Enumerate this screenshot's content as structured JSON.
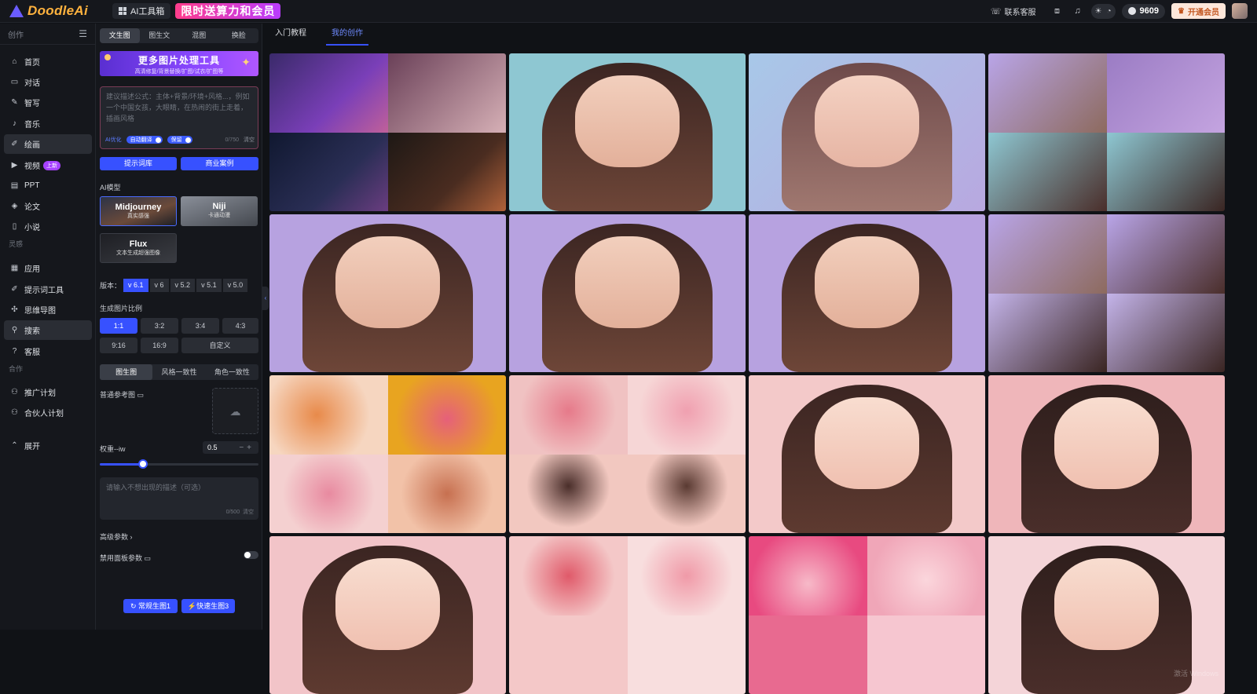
{
  "app": {
    "name": "DoodleAi",
    "tools_label": "AI工具箱",
    "promo_label": "限时送算力和会员"
  },
  "topbar": {
    "support_label": "联系客服",
    "coins": "9609",
    "vip_label": "开通会员"
  },
  "sidebar": {
    "section_create": "创作",
    "items": [
      {
        "label": "首页",
        "icon": "home-icon"
      },
      {
        "label": "对话",
        "icon": "chat-icon"
      },
      {
        "label": "智写",
        "icon": "write-icon"
      },
      {
        "label": "音乐",
        "icon": "music-icon"
      },
      {
        "label": "绘画",
        "icon": "brush-icon"
      },
      {
        "label": "视频",
        "icon": "video-icon",
        "badge": "上新"
      },
      {
        "label": "PPT",
        "icon": "ppt-icon"
      },
      {
        "label": "论文",
        "icon": "paper-icon"
      },
      {
        "label": "小说",
        "icon": "novel-icon"
      }
    ],
    "section_inspire": "灵感",
    "items2": [
      {
        "label": "应用",
        "icon": "apps-icon"
      },
      {
        "label": "提示词工具",
        "icon": "prompt-tool-icon"
      },
      {
        "label": "思维导图",
        "icon": "mindmap-icon"
      },
      {
        "label": "搜索",
        "icon": "search-icon"
      },
      {
        "label": "客服",
        "icon": "help-icon"
      }
    ],
    "section_coop": "合作",
    "items3": [
      {
        "label": "推广计划",
        "icon": "promo-icon"
      },
      {
        "label": "合伙人计划",
        "icon": "partner-icon"
      }
    ],
    "expand_label": "展开"
  },
  "panel": {
    "mode_tabs": [
      "文生图",
      "图生文",
      "混图",
      "换脸"
    ],
    "banner_title": "更多图片处理工具",
    "banner_sub": "高清修复/背景替换/扩图/试衣/扩图等",
    "prompt_placeholder": "建议描述公式：主体+背景/环境+风格...，例如一个中国女孩，大眼睛，在热闹的街上走着，插画风格",
    "ai_label": "AI优化",
    "toggle_auto": "自动翻译",
    "toggle_keep": "保留",
    "prompt_count": "0/750",
    "clear_label": "清空",
    "btn_prompt_lib": "提示词库",
    "btn_examples": "商业案例",
    "model_label": "AI模型",
    "models": [
      {
        "name": "Midjourney",
        "sub": "真实感强"
      },
      {
        "name": "Niji",
        "sub": "卡通动漫"
      },
      {
        "name": "Flux",
        "sub": "文本生成超强图像"
      }
    ],
    "version_label": "版本：",
    "versions": [
      "v 6.1",
      "v 6",
      "v 5.2",
      "v 5.1",
      "v 5.0"
    ],
    "ratio_label": "生成图片比例",
    "ratios": [
      "1:1",
      "3:2",
      "3:4",
      "4:3",
      "9:16",
      "16:9",
      "自定义"
    ],
    "gen_tabs": [
      "图生图",
      "风格一致性",
      "角色一致性"
    ],
    "ref_label": "普通参考图",
    "iw_label": "权重--iw",
    "iw_value": "0.5",
    "iw_fraction": 0.27,
    "neg_placeholder": "请输入不想出现的描述（可选）",
    "neg_count": "0/500",
    "adv_label": "高级参数",
    "panel_params_label": "禁用面板参数",
    "btn_normal": "常规生图1",
    "btn_fast": "快速生图3"
  },
  "main": {
    "tabs": [
      "入门教程",
      "我的创作"
    ],
    "watermark": "激活 Windows"
  }
}
